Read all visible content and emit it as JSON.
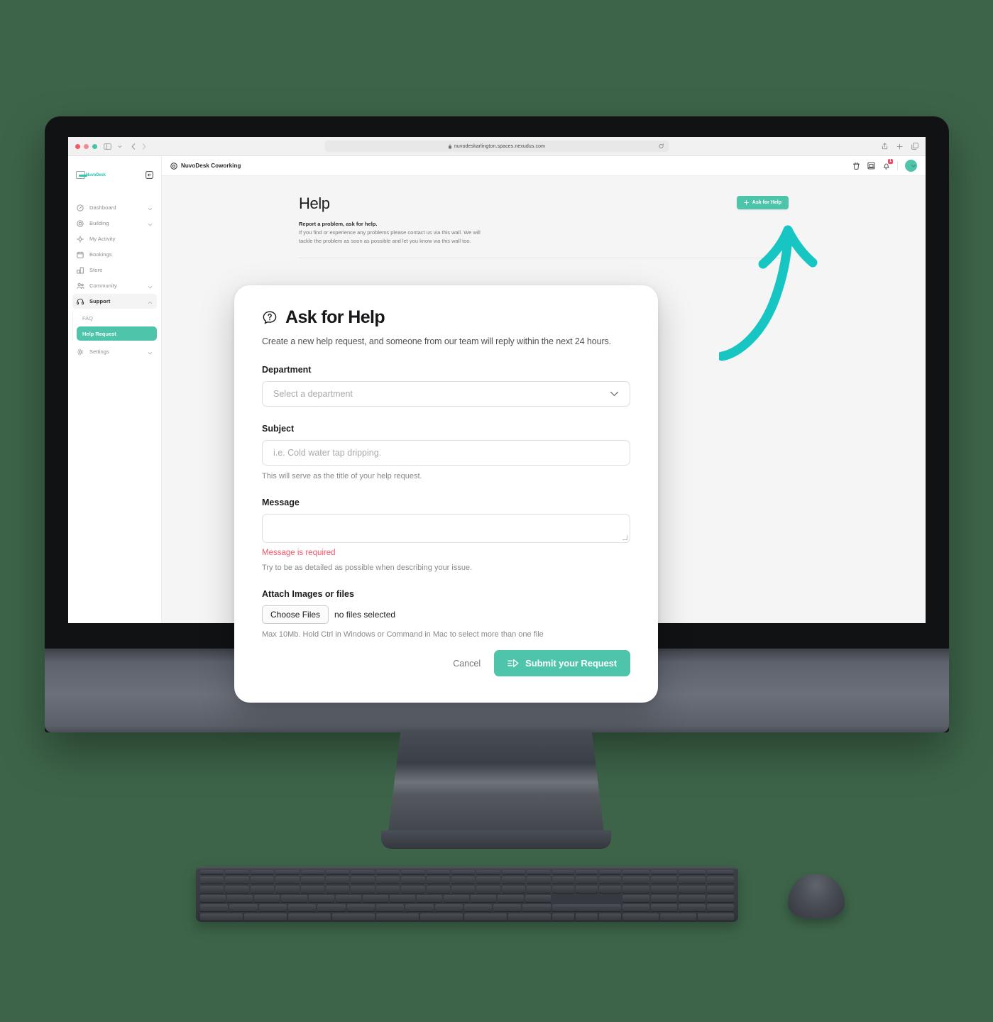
{
  "browser": {
    "url": "nuvodeskarlington.spaces.nexudus.com",
    "lock_icon": "lock-icon",
    "reload_icon": "reload-icon",
    "sidebar_toggle_icon": "sidebar-toggle-icon",
    "back_icon": "back-arrow-icon",
    "forward_icon": "forward-arrow-icon",
    "share_icon": "share-icon",
    "new_tab_icon": "plus-icon",
    "tabs_icon": "tab-overview-icon"
  },
  "sidebar": {
    "logo_text": "NuvoDesk",
    "collapse_icon": "collapse-sidebar-icon",
    "items": [
      {
        "label": "Dashboard",
        "icon": "speedometer-icon",
        "expandable": true,
        "active": false
      },
      {
        "label": "Building",
        "icon": "building-icon",
        "expandable": true,
        "active": false
      },
      {
        "label": "My Activity",
        "icon": "activity-icon",
        "expandable": false,
        "active": false
      },
      {
        "label": "Bookings",
        "icon": "calendar-icon",
        "expandable": false,
        "active": false
      },
      {
        "label": "Store",
        "icon": "store-icon",
        "expandable": false,
        "active": false
      },
      {
        "label": "Community",
        "icon": "people-icon",
        "expandable": true,
        "active": false
      },
      {
        "label": "Support",
        "icon": "headset-icon",
        "expandable": true,
        "active": true
      }
    ],
    "sub_items": [
      {
        "label": "FAQ",
        "current": false
      },
      {
        "label": "Help Request",
        "current": true
      }
    ],
    "settings": {
      "label": "Settings",
      "icon": "gear-icon",
      "expandable": true
    }
  },
  "topbar": {
    "site_icon": "location-pin-icon",
    "site_name": "NuvoDesk Coworking",
    "icons": [
      {
        "name": "coffee-cup-icon",
        "badge": ""
      },
      {
        "name": "printer-icon",
        "badge": ""
      },
      {
        "name": "notification-bell-icon",
        "badge": "1"
      }
    ],
    "avatar": "user-avatar",
    "account_chevron_icon": "chevron-down-icon"
  },
  "page": {
    "title": "Help",
    "subtitle_strong": "Report a problem, ask for help.",
    "subtitle": "If you find or experience any problems please contact us via this wall. We will tackle the problem as soon as possible and let you know via this wall too.",
    "ask_button": {
      "label": "Ask for Help",
      "icon": "plus-icon"
    },
    "annotation_arrow": "curved-arrow-annotation"
  },
  "modal": {
    "icon": "question-chat-icon",
    "title": "Ask for Help",
    "description": "Create a new help request, and someone from our team will reply within the next 24 hours.",
    "department": {
      "label": "Department",
      "value": "",
      "placeholder": "Select a department",
      "chevron_icon": "chevron-down-icon"
    },
    "subject": {
      "label": "Subject",
      "value": "",
      "placeholder": "i.e. Cold water tap dripping.",
      "hint": "This will serve as the title of your help request."
    },
    "message": {
      "label": "Message",
      "value": "",
      "error": "Message is required",
      "hint": "Try to be as detailed as possible when describing your issue."
    },
    "attach": {
      "label": "Attach Images or files",
      "button": "Choose Files",
      "status": "no files selected",
      "hint": "Max 10Mb. Hold Ctrl in Windows or Command in Mac to select more than one file"
    },
    "cancel_label": "Cancel",
    "submit_label": "Submit your Request",
    "submit_icon": "send-icon"
  },
  "colors": {
    "background": "#3d6449",
    "brand_teal": "#4ec5ab",
    "annotation_teal": "#17c5c2",
    "error_red": "#f4556b",
    "badge_red": "#f0485e"
  }
}
